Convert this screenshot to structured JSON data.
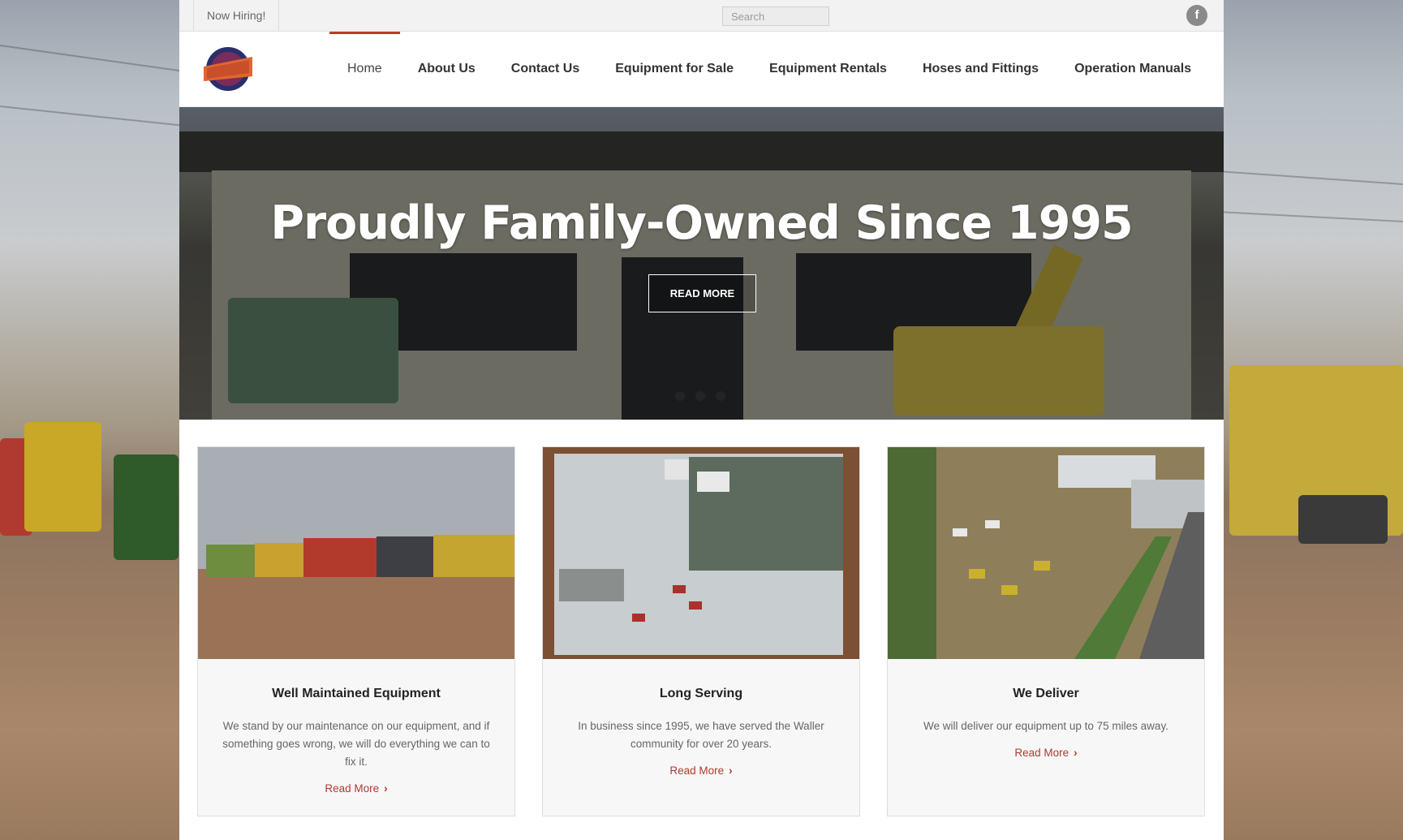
{
  "topbar": {
    "now_hiring": "Now Hiring!",
    "search_placeholder": "Search",
    "facebook_glyph": "f"
  },
  "nav": {
    "items": [
      {
        "label": "Home",
        "active": true
      },
      {
        "label": "About Us"
      },
      {
        "label": "Contact Us"
      },
      {
        "label": "Equipment for Sale"
      },
      {
        "label": "Equipment Rentals"
      },
      {
        "label": "Hoses and Fittings"
      },
      {
        "label": "Operation Manuals"
      }
    ]
  },
  "hero": {
    "title": "Proudly Family-Owned Since 1995",
    "button": "READ MORE",
    "slide_count": 3
  },
  "cards": [
    {
      "title": "Well Maintained Equipment",
      "text": "We stand by our maintenance on our equipment, and if something goes wrong, we will do everything we can to fix it.",
      "link": "Read More"
    },
    {
      "title": "Long Serving",
      "text": "In business since 1995, we have served the Waller community for over 20 years.",
      "link": "Read More"
    },
    {
      "title": "We Deliver",
      "text": "We will deliver our equipment up to 75 miles away.",
      "link": "Read More"
    }
  ],
  "colors": {
    "accent": "#c0392b",
    "link": "#b03a2e",
    "topbar_bg": "#f2f2f2"
  }
}
